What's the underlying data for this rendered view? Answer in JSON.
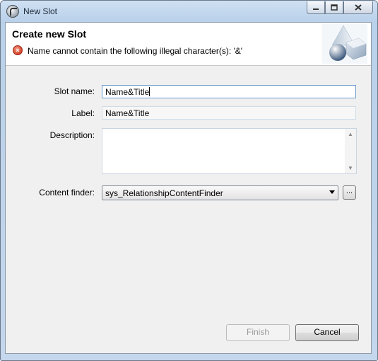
{
  "window": {
    "title": "New Slot"
  },
  "banner": {
    "title": "Create new Slot",
    "error_message": "Name cannot contain the following illegal character(s): '&'"
  },
  "form": {
    "slot_name_label": "Slot name:",
    "slot_name_value": "Name&Title",
    "label_label": "Label:",
    "label_value": "Name&Title",
    "description_label": "Description:",
    "description_value": "",
    "content_finder_label": "Content finder:",
    "content_finder_value": "sys_RelationshipContentFinder",
    "browse_label": "..."
  },
  "buttons": {
    "finish": "Finish",
    "cancel": "Cancel"
  },
  "icons": {
    "app": "app-icon",
    "error": "error-icon",
    "wizard": "wizard-shapes-icon",
    "minimize": "minimize-icon",
    "maximize": "maximize-icon",
    "close": "close-icon"
  },
  "colors": {
    "error": "#d2442a",
    "title_bar": "#b9d1ea"
  }
}
